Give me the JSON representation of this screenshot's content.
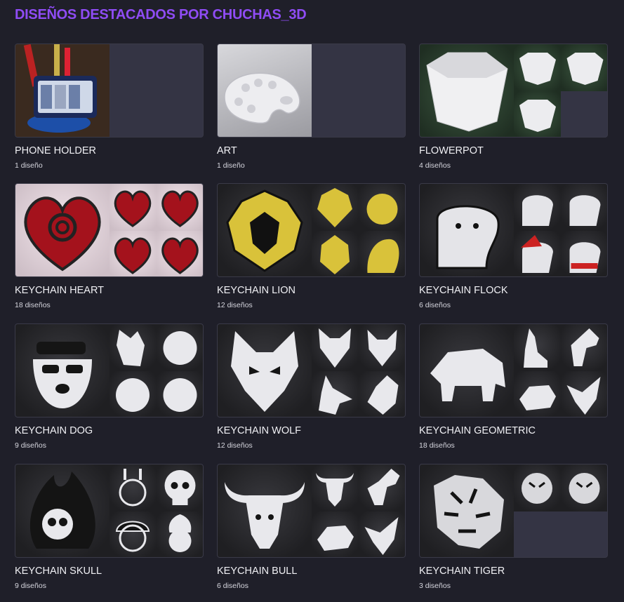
{
  "header": {
    "title": "DISEÑOS DESTACADOS POR CHUCHAS_3D"
  },
  "collections": [
    {
      "name": "PHONE HOLDER",
      "count": "1 diseño",
      "icon": "phone-holder-photo"
    },
    {
      "name": "ART",
      "count": "1 diseño",
      "icon": "palette-photo"
    },
    {
      "name": "FLOWERPOT",
      "count": "4 diseños",
      "icon": "flowerpot-photo"
    },
    {
      "name": "KEYCHAIN HEART",
      "count": "18 diseños",
      "icon": "heart-keychain-photo"
    },
    {
      "name": "KEYCHAIN LION",
      "count": "12 diseños",
      "icon": "lion-keychain-photo"
    },
    {
      "name": "KEYCHAIN FLOCK",
      "count": "6 diseños",
      "icon": "flock-keychain-photo"
    },
    {
      "name": "KEYCHAIN DOG",
      "count": "9 diseños",
      "icon": "dog-keychain-photo"
    },
    {
      "name": "KEYCHAIN WOLF",
      "count": "12 diseños",
      "icon": "wolf-keychain-photo"
    },
    {
      "name": "KEYCHAIN GEOMETRIC",
      "count": "18 diseños",
      "icon": "geometric-keychain-photo"
    },
    {
      "name": "KEYCHAIN SKULL",
      "count": "9 diseños",
      "icon": "skull-keychain-photo"
    },
    {
      "name": "KEYCHAIN BULL",
      "count": "6 diseños",
      "icon": "bull-keychain-photo"
    },
    {
      "name": "KEYCHAIN TIGER",
      "count": "3 diseños",
      "icon": "tiger-keychain-photo"
    }
  ],
  "colors": {
    "accent": "#8f4cf5",
    "background": "#1f1f29",
    "placeholder_tile": "#343444",
    "lion_gold": "#d9c23a",
    "heart_red": "#a4121c"
  }
}
